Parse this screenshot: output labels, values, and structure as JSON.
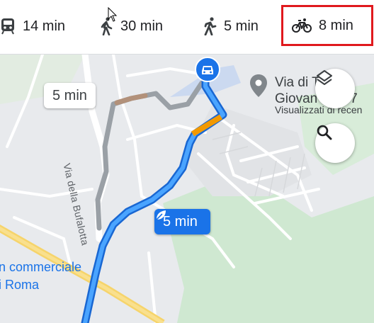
{
  "travel_modes": [
    {
      "icon": "transit-icon",
      "time": "14 min"
    },
    {
      "icon": "walking-icon",
      "time": "30 min"
    },
    {
      "icon": "rideshare-icon",
      "time": "5 min"
    },
    {
      "icon": "bicycle-icon",
      "time": "8 min",
      "selected": true
    }
  ],
  "map": {
    "place_title": "Via di T...\nGiovan...7",
    "place_title_line1": "Via di T",
    "place_title_line2": "Giovan",
    "place_title_tail": "7",
    "place_subtitle": "Visualizzati di recen",
    "road_label": "Via della Bufalotta",
    "poi_line1": "n commerciale",
    "poi_line2": "i Roma",
    "alt_route_time": "5 min",
    "main_route_time": "5 min",
    "origin_icon": "car-icon",
    "colors": {
      "route": "#1a73e8",
      "route_light": "#4fa3f7",
      "traffic_slow": "#f29900",
      "alt_route": "#9aa0a6",
      "park": "#cde9d0",
      "highlight": "#e0191d"
    }
  }
}
